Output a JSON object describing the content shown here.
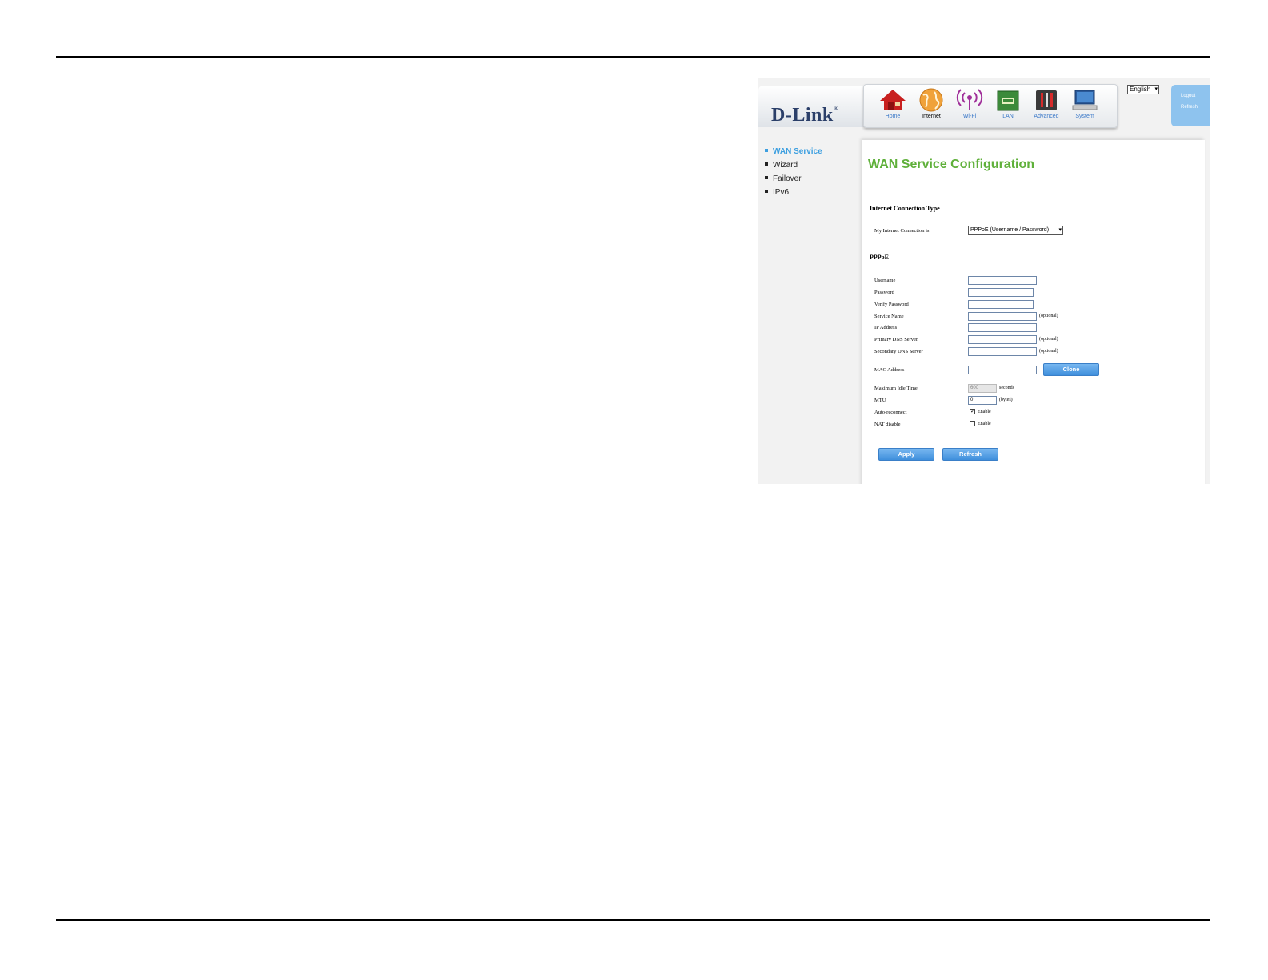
{
  "brand": {
    "logo_text": "D-Link"
  },
  "nav": {
    "items": [
      {
        "label": "Home",
        "icon": "home-icon"
      },
      {
        "label": "Internet",
        "icon": "globe-icon",
        "active": true
      },
      {
        "label": "Wi-Fi",
        "icon": "wifi-icon"
      },
      {
        "label": "LAN",
        "icon": "lan-icon"
      },
      {
        "label": "Advanced",
        "icon": "tools-icon"
      },
      {
        "label": "System",
        "icon": "monitor-icon"
      }
    ]
  },
  "language": {
    "selected": "English"
  },
  "session": {
    "logout_label": "Logout",
    "refresh_label": "Refresh"
  },
  "sidebar": {
    "items": [
      {
        "label": "WAN Service",
        "active": true
      },
      {
        "label": "Wizard"
      },
      {
        "label": "Failover"
      },
      {
        "label": "IPv6"
      }
    ]
  },
  "page": {
    "title": "WAN Service Configuration"
  },
  "connection": {
    "section_title": "Internet Connection Type",
    "label": "My Internet Connection is",
    "selected": "PPPoE (Username / Password)"
  },
  "pppoe": {
    "section_title": "PPPoE",
    "username_label": "Username",
    "password_label": "Password",
    "verify_password_label": "Verify Password",
    "service_name_label": "Service Name",
    "ip_address_label": "IP Address",
    "primary_dns_label": "Primary DNS Server",
    "secondary_dns_label": "Secondary DNS Server",
    "optional_note": "(optional)",
    "mac_address_label": "MAC Address",
    "clone_label": "Clone",
    "max_idle_label": "Maximum Idle Time",
    "max_idle_value": "600",
    "max_idle_unit": "seconds",
    "mtu_label": "MTU",
    "mtu_value": "0",
    "mtu_unit": "(bytes)",
    "auto_reconnect_label": "Auto-reconnect",
    "auto_reconnect_checked": true,
    "nat_disable_label": "NAT disable",
    "nat_disable_checked": false,
    "enable_label": "Enable"
  },
  "actions": {
    "apply_label": "Apply",
    "refresh_label": "Refresh"
  },
  "colors": {
    "accent_blue": "#3c9fe0",
    "title_green": "#5fb03a",
    "logo_navy": "#2b3f69"
  }
}
